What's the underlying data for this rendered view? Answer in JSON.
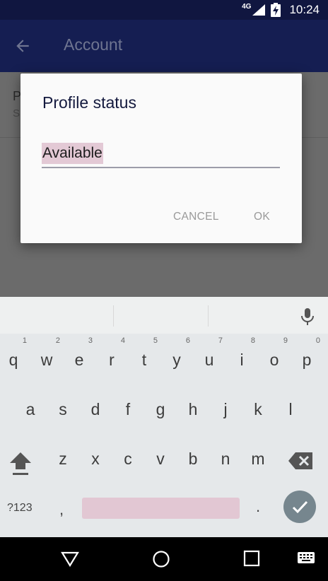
{
  "status_bar": {
    "network": "4G",
    "time": "10:24"
  },
  "toolbar": {
    "title": "Account",
    "back_icon": "arrow-back-icon"
  },
  "background_list": {
    "item_title": "P",
    "item_subtitle": "S"
  },
  "dialog": {
    "title": "Profile status",
    "input_value": "Available",
    "cancel_label": "CANCEL",
    "ok_label": "OK"
  },
  "keyboard": {
    "row1": [
      {
        "k": "q",
        "h": "1"
      },
      {
        "k": "w",
        "h": "2"
      },
      {
        "k": "e",
        "h": "3"
      },
      {
        "k": "r",
        "h": "4"
      },
      {
        "k": "t",
        "h": "5"
      },
      {
        "k": "y",
        "h": "6"
      },
      {
        "k": "u",
        "h": "7"
      },
      {
        "k": "i",
        "h": "8"
      },
      {
        "k": "o",
        "h": "9"
      },
      {
        "k": "p",
        "h": "0"
      }
    ],
    "row2": [
      "a",
      "s",
      "d",
      "f",
      "g",
      "h",
      "j",
      "k",
      "l"
    ],
    "row3": [
      "z",
      "x",
      "c",
      "v",
      "b",
      "n",
      "m"
    ],
    "symbols_label": "?123",
    "comma_label": ",",
    "period_label": "."
  },
  "colors": {
    "toolbar": "#151e52",
    "statusbar": "#101640",
    "selection": "#e3c9d5",
    "accent": "#76868e"
  }
}
